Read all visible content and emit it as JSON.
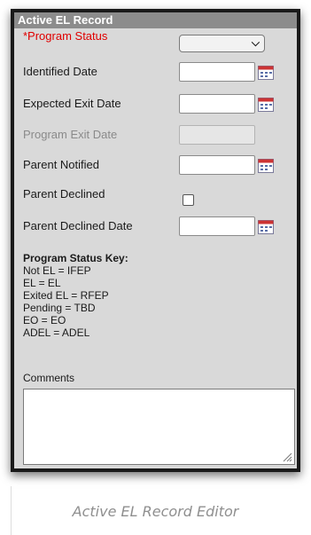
{
  "panel": {
    "title": "Active EL Record"
  },
  "fields": {
    "program_status": {
      "label": "*Program Status",
      "value": ""
    },
    "identified_date": {
      "label": "Identified Date",
      "value": ""
    },
    "expected_exit_date": {
      "label": "Expected Exit Date",
      "value": ""
    },
    "program_exit_date": {
      "label": "Program Exit Date",
      "value": ""
    },
    "parent_notified": {
      "label": "Parent Notified",
      "value": ""
    },
    "parent_declined": {
      "label": "Parent Declined",
      "checked": false
    },
    "parent_declined_date": {
      "label": "Parent Declined Date",
      "value": ""
    }
  },
  "status_key": {
    "title": "Program Status Key:",
    "lines": [
      "Not EL = IFEP",
      "EL = EL",
      "Exited EL = RFEP",
      "Pending = TBD",
      "EO = EO",
      "ADEL = ADEL"
    ]
  },
  "comments": {
    "label": "Comments",
    "value": ""
  },
  "icons": {
    "calendar": "calendar-icon",
    "dropdown": "chevron-down-icon",
    "resize": "resize-grip-icon"
  },
  "colors": {
    "required": "#e00000",
    "title_bar": "#8c8c8c",
    "panel_bg": "#d9d9d9",
    "calendar_accent": "#cc3333"
  },
  "caption": "Active EL Record Editor"
}
